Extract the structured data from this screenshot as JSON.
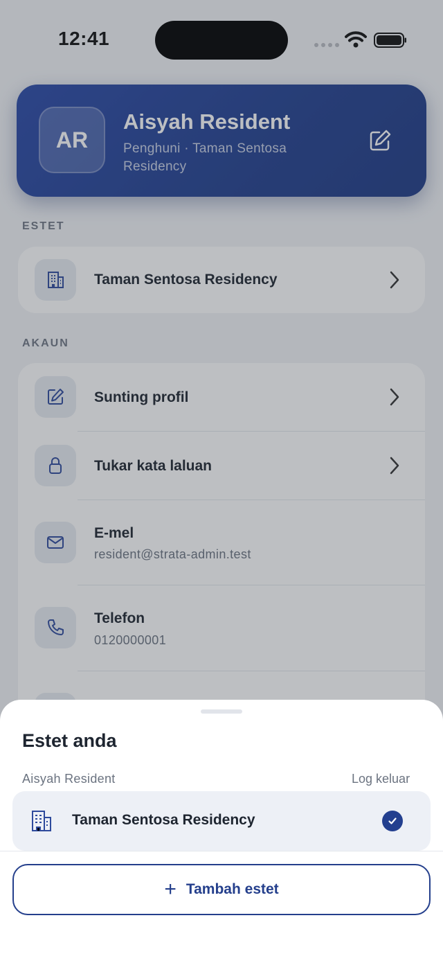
{
  "status_bar": {
    "time": "12:41"
  },
  "profile": {
    "initials": "AR",
    "name": "Aisyah Resident",
    "subtitle": "Penghuni · Taman Sentosa Residency"
  },
  "estate_section": {
    "label": "ESTET",
    "item": {
      "name": "Taman Sentosa Residency",
      "icon": "building-icon"
    }
  },
  "account_section": {
    "label": "AKAUN",
    "items": [
      {
        "title": "Sunting profil",
        "icon": "pencil-icon"
      },
      {
        "title": "Tukar kata laluan",
        "icon": "lock-icon"
      },
      {
        "title": "E-mel",
        "value": "resident@strata-admin.test",
        "icon": "mail-icon"
      },
      {
        "title": "Telefon",
        "value": "0120000001",
        "icon": "phone-icon"
      }
    ]
  },
  "sheet": {
    "title": "Estet anda",
    "user_name": "Aisyah Resident",
    "logout_label": "Log keluar",
    "estates": [
      {
        "name": "Taman Sentosa Residency",
        "selected": true
      }
    ],
    "add_label": "Tambah estet",
    "add_icon": "plus-icon"
  },
  "colors": {
    "primary": "#243f8c",
    "card_bg": "#ffffff",
    "page_bg": "#f2f4f7"
  }
}
